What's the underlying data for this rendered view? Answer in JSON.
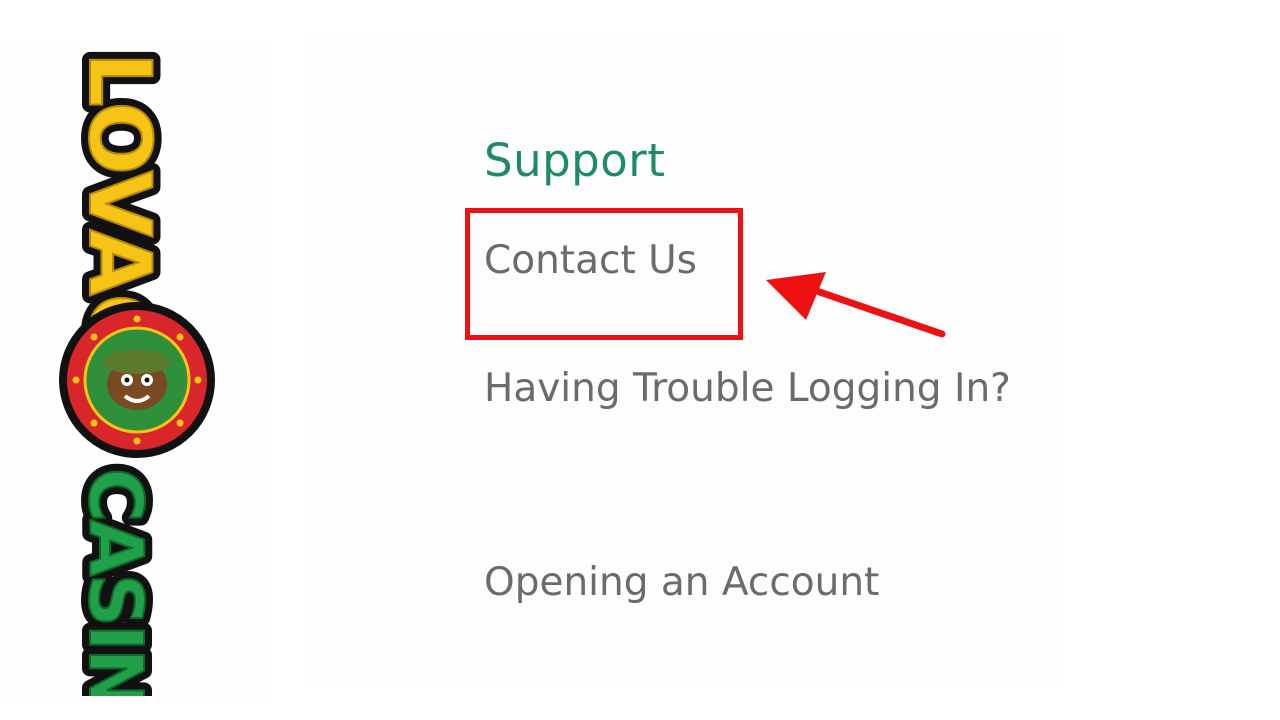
{
  "logo": {
    "alt_text": "CASINOLOVAC",
    "colors": {
      "casino_green": "#21a04a",
      "lovac_gold": "#f6c417",
      "outline": "#111111",
      "badge_red": "#d8262a",
      "badge_green": "#2f8f3a"
    }
  },
  "support_menu": {
    "title": "Support",
    "items": [
      {
        "label": "Contact Us",
        "highlighted": true
      },
      {
        "label": "Having Trouble Logging In?",
        "highlighted": false
      },
      {
        "label": "Opening an Account",
        "highlighted": false
      }
    ]
  },
  "annotation": {
    "highlight_color": "#ee1111",
    "arrow_color": "#ee1111",
    "arrow_icon": "arrow-left-icon"
  },
  "colors": {
    "title": "#1f8a6a",
    "link": "#6b6b6b",
    "background": "#ffffff"
  }
}
